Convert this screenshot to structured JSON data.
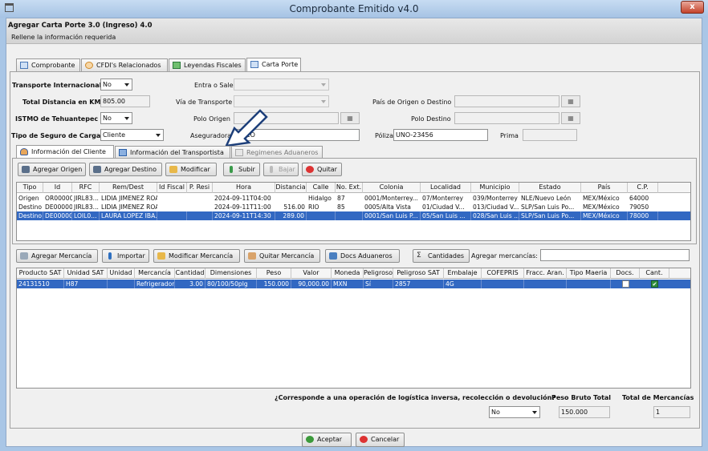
{
  "window": {
    "title": "Comprobante Emitido v4.0",
    "close": "x"
  },
  "header": {
    "title": "Agregar Carta Porte 3.0 (Ingreso) 4.0",
    "subtitle": "Rellene la información requerida"
  },
  "tabs": [
    {
      "label": "Comprobante",
      "active": false
    },
    {
      "label": "CFDI's Relacionados",
      "active": false
    },
    {
      "label": "Leyendas Fiscales",
      "active": false
    },
    {
      "label": "Carta Porte",
      "active": true
    }
  ],
  "form": {
    "transporte_internacional": {
      "label": "Transporte Internacional",
      "value": "No"
    },
    "entra_sale": {
      "label": "Entra o Sale",
      "value": ""
    },
    "total_distancia": {
      "label": "Total Distancia en KM",
      "value": "805.00"
    },
    "via_transporte": {
      "label": "Vía de Transporte",
      "value": ""
    },
    "pais_origen_destino": {
      "label": "País de Origen o Destino",
      "value": ""
    },
    "istmo": {
      "label": "ISTMO de Tehuantepec",
      "value": "No"
    },
    "polo_origen": {
      "label": "Polo Origen",
      "value": ""
    },
    "polo_destino": {
      "label": "Polo Destino",
      "value": ""
    },
    "tipo_seguro": {
      "label": "Tipo de Seguro de Carga",
      "value": "Cliente"
    },
    "aseguradora": {
      "label": "Aseguradora",
      "value": "CO"
    },
    "poliza": {
      "label": "Póliza",
      "value": "UNO-23456"
    },
    "prima": {
      "label": "Prima",
      "value": ""
    }
  },
  "subtabs": [
    {
      "label": "Información del Cliente",
      "active": true
    },
    {
      "label": "Información del Transportista",
      "active": false
    },
    {
      "label": "Regimenes Aduaneros",
      "active": false
    }
  ],
  "client_toolbar": {
    "agregar_origen": "Agregar Origen",
    "agregar_destino": "Agregar Destino",
    "modificar": "Modificar",
    "subir": "Subir",
    "bajar": "Bajar",
    "quitar": "Quitar"
  },
  "ubicaciones": {
    "columns": [
      "Tipo",
      "Id",
      "RFC",
      "Rem/Dest",
      "Id Fiscal",
      "P. Resi",
      "Hora",
      "Distancia",
      "Calle",
      "No. Ext.",
      "Colonia",
      "Localidad",
      "Municipio",
      "Estado",
      "País",
      "C.P."
    ],
    "rows": [
      [
        "Origen",
        "OR000005",
        "JIRL83...",
        "LIDIA JIMENEZ ROA",
        "",
        "",
        "2024-09-11T04:00",
        "",
        "Hidalgo",
        "87",
        "0001/Monterrey...",
        "07/Monterrey",
        "039/Monterrey",
        "NLE/Nuevo León",
        "MEX/México",
        "64000"
      ],
      [
        "Destino",
        "DE000002",
        "JIRL83...",
        "LIDIA JIMENEZ ROA",
        "",
        "",
        "2024-09-11T11:00",
        "516.00",
        "RIO",
        "85",
        "0005/Alta Vista",
        "01/Ciudad V...",
        "013/Ciudad V...",
        "SLP/San Luis Po...",
        "MEX/México",
        "79050"
      ],
      [
        "Destino",
        "DE000001",
        "LOIL0...",
        "LAURA LOPEZ IBA...",
        "",
        "",
        "2024-09-11T14:30",
        "289.00",
        "",
        "",
        "0001/San Luis P...",
        "05/San Luis ...",
        "028/San Luis ...",
        "SLP/San Luis Po...",
        "MEX/México",
        "78000"
      ]
    ],
    "selected_row": 2
  },
  "merc_toolbar": {
    "agregar": "Agregar Mercancía",
    "importar": "Importar",
    "modificar": "Modificar Mercancía",
    "quitar": "Quitar Mercancía",
    "docs": "Docs Aduaneros",
    "cantidades": "Cantidades",
    "agregar_label": "Agregar mercancías:",
    "agregar_value": ""
  },
  "mercancias": {
    "columns": [
      "Producto SAT",
      "Unidad SAT",
      "Unidad",
      "Mercancía",
      "Cantidad",
      "Dimensiones",
      "Peso",
      "Valor",
      "Moneda",
      "Peligroso",
      "Peligroso SAT",
      "Embalaje",
      "COFEPRIS",
      "Fracc. Aran.",
      "Tipo Maeria",
      "Docs.",
      "Cant."
    ],
    "rows": [
      [
        "24131510",
        "H87",
        "",
        "Refrigerador",
        "3.00",
        "80/100/50plg",
        "150.000",
        "90,000.00",
        "MXN",
        "Sí",
        "2857",
        "4G",
        "",
        "",
        "",
        "false",
        "true"
      ]
    ]
  },
  "footer": {
    "logistica_q": "¿Corresponde a una operación de logística inversa, recolección o devolución?",
    "logistica_value": "No",
    "peso_label": "Peso Bruto Total",
    "peso_value": "150.000",
    "total_label": "Total de Mercancías",
    "total_value": "1",
    "aceptar": "Aceptar",
    "cancelar": "Cancelar"
  },
  "colors": {
    "titlebar": "#b4cde9",
    "selection": "#3268c2",
    "window_bg": "#f0f0f0"
  }
}
